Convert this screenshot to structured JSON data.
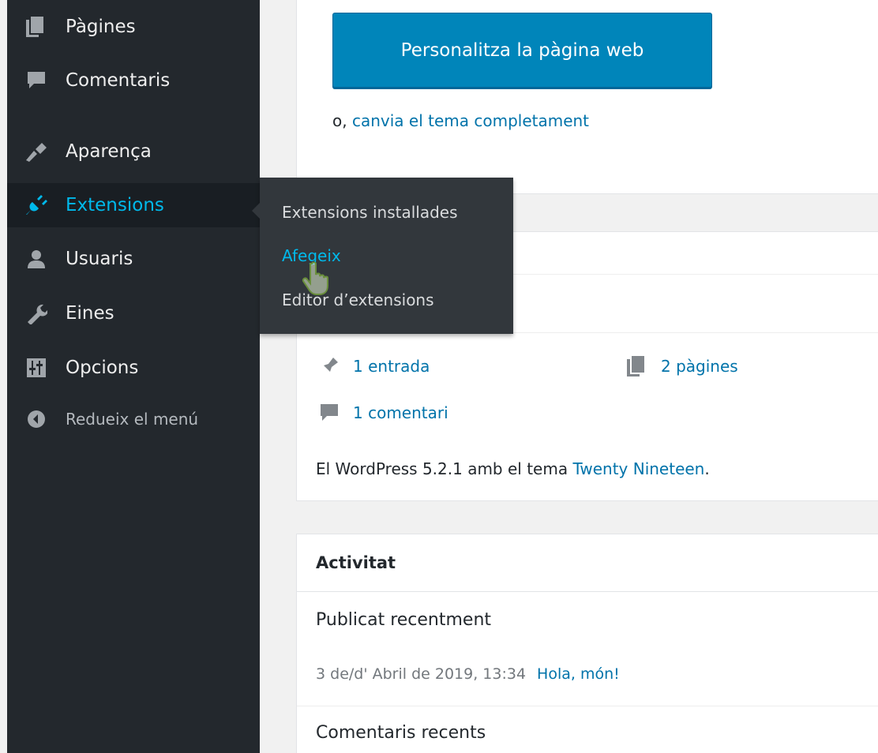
{
  "sidebar": {
    "items": [
      {
        "label": "Pàgines",
        "icon": "pages-icon"
      },
      {
        "label": "Comentaris",
        "icon": "comments-icon"
      },
      {
        "label": "Aparença",
        "icon": "appearance-icon"
      },
      {
        "label": "Extensions",
        "icon": "plugins-icon",
        "active": true
      },
      {
        "label": "Usuaris",
        "icon": "users-icon"
      },
      {
        "label": "Eines",
        "icon": "tools-icon"
      },
      {
        "label": "Opcions",
        "icon": "settings-icon"
      }
    ],
    "collapse_label": "Redueix el menú"
  },
  "flyout": {
    "items": [
      {
        "label": "Extensions installades"
      },
      {
        "label": "Afegeix",
        "current": true
      },
      {
        "label": "Editor d’extensions"
      }
    ]
  },
  "welcome": {
    "customize_button": "Personalitza la pàgina web",
    "change_theme_prefix": "o,",
    "change_theme_link": "canvia el tema completament"
  },
  "at_a_glance": {
    "posts": "1 entrada",
    "pages": "2 pàgines",
    "comments": "1 comentari",
    "version_prefix": "El WordPress 5.2.1 amb el tema",
    "theme_link": "Twenty Nineteen",
    "version_suffix": "."
  },
  "activity": {
    "title": "Activitat",
    "recently_published": "Publicat recentment",
    "post_date": "3 de/d' Abril de 2019, 13:34",
    "post_link": "Hola, món!",
    "recent_comments": "Comentaris recents"
  },
  "colors": {
    "sidebar_bg": "#23282d",
    "accent": "#00b9eb",
    "button": "#0085ba",
    "link": "#0073aa"
  }
}
